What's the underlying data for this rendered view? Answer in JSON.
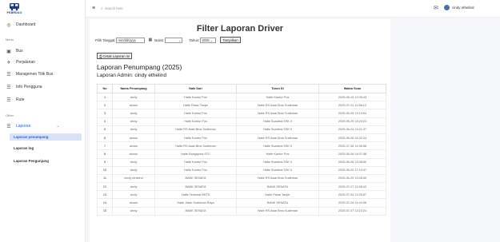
{
  "brand": {
    "name": "PKBRDAO"
  },
  "topbar": {
    "search_placeholder": "Search here",
    "user_name": "cindy ethelind"
  },
  "sidebar": {
    "dashboard": "Dashboard",
    "section_menu": "Menu",
    "items": [
      {
        "label": "Bus",
        "icon": "bus-icon"
      },
      {
        "label": "Perjalanan",
        "icon": "route-icon"
      },
      {
        "label": "Manajemen Titik Bus",
        "icon": "list-icon"
      },
      {
        "label": "Info Pengguna",
        "icon": "list-icon"
      },
      {
        "label": "Rute",
        "icon": "list-icon"
      }
    ],
    "section_other": "Other",
    "laporan": "Laporan",
    "sub_items": [
      {
        "label": "Laporan penumpang",
        "active": true
      },
      {
        "label": "Laporan log",
        "active": false
      },
      {
        "label": "Laporan Pengunjung",
        "active": false
      }
    ]
  },
  "filter": {
    "title": "Filter Laporan Driver",
    "date_label": "Pilih Tanggal:",
    "date_value": "mm/dd/yyyy",
    "month_label": "Bulan:",
    "month_value": "",
    "year_label": "Tahun:",
    "year_value": "2025",
    "submit_label": "Tampilkan"
  },
  "print_label": "Cetak Laporan ini",
  "report": {
    "title": "Laporan Penumpang (2025)",
    "admin_line": "Laporan Admin: cindy ethelind",
    "columns": [
      "No",
      "Nama Penumpang",
      "Naik Dari",
      "Turun Di",
      "Waktu Scan"
    ],
    "rows": [
      [
        "1",
        "cindy",
        "Halte Kantor Pos",
        "Halte Kantor Pos",
        "2025-06-10 12:05:43"
      ],
      [
        "2",
        "alvaro",
        "Halte Pasar Tanjer",
        "Halte RS Awal Bros Sudirman",
        "2025-07-01 11:56:13"
      ],
      [
        "3",
        "cindy",
        "Halte Kantor Pos",
        "Halte RS Awal Bros Sudirman",
        "2025-05-29 13:13:54"
      ],
      [
        "4",
        "cindy",
        "Halte Kantor Pos",
        "Halte Suadera SSK II",
        "2025-06-29 13:24:23"
      ],
      [
        "5",
        "cindy",
        "Halte RS Awal Bros Sudirman",
        "Halte Suadera SSK II",
        "2025-06-24 13:21:37"
      ],
      [
        "6",
        "alvaro",
        "Halte Kantor Pos",
        "Halte RS Awal Bros Sudirman",
        "2025-06-26 15:42:24"
      ],
      [
        "7",
        "alvaro",
        "Halte RS Awal Bros Sudirman",
        "Halte Suadera SSK II",
        "2025-07-06 14:36:58"
      ],
      [
        "8",
        "alvaro",
        "Halte Bangayma STC",
        "Halte Kantor Pos",
        "2025-05-26 14:07:58"
      ],
      [
        "9",
        "cindy",
        "Halte Kantor Pos",
        "Halte Suadera SSK II",
        "2025-06-26 13:08:50"
      ],
      [
        "10",
        "cindy",
        "Halte Kantor Pos",
        "Halte Suadera SSK II",
        "2025-06-20 17:10:47"
      ],
      [
        "11",
        "cindy ethelind",
        "BANK SENATA",
        "Halte RS Awal Bros Sudirman",
        "2025-06-29 13:28:45"
      ],
      [
        "12",
        "cindy",
        "BANK SENATA",
        "BANK SENATA",
        "2025-07-07 11:58:43"
      ],
      [
        "13",
        "cindy",
        "Halte Terminal BRTS",
        "Halte Pasar Tanjer",
        "2025-07-04 13:25:57"
      ],
      [
        "14",
        "alvaro",
        "Halte Jalan Sudirman Raya",
        "BANK SENATA",
        "2025-07-04 11:44:36"
      ],
      [
        "15",
        "cindy",
        "BANK SENATA",
        "Halte RS Awal Bros Sudirman",
        "2025-07-07 13:10:24"
      ]
    ]
  }
}
